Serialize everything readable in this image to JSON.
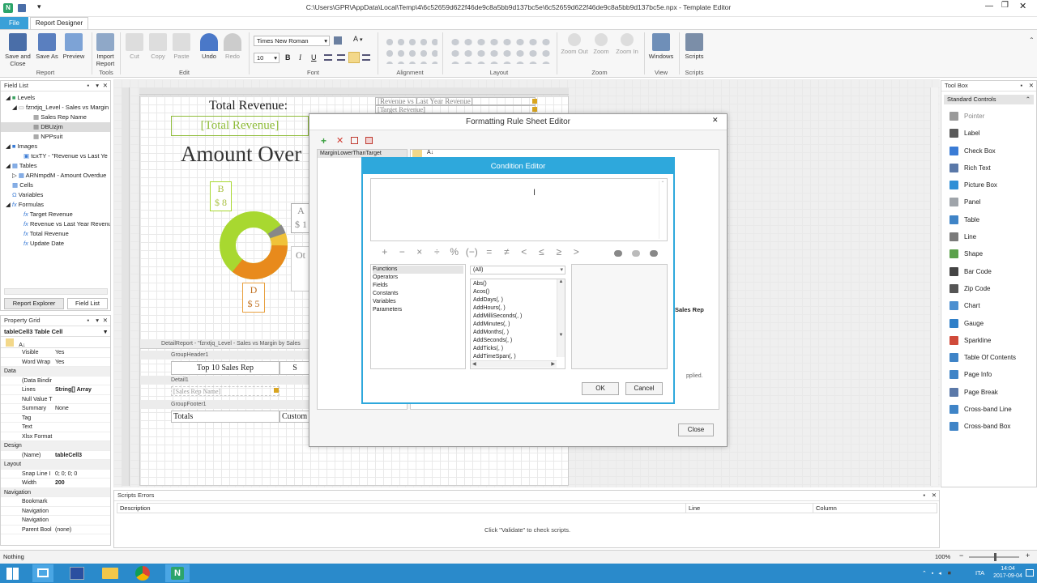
{
  "window": {
    "title": "C:\\Users\\GPR\\AppData\\Local\\Temp\\4\\6c52659d622f46de9c8a5bb9d137bc5e\\6c52659d622f46de9c8a5bb9d137bc5e.npx - Template Editor",
    "tab_file": "File",
    "tab_report_designer": "Report Designer"
  },
  "ribbon": {
    "save_close": "Save and Close",
    "save_as": "Save As",
    "preview": "Preview",
    "import_report": "Import Report",
    "cut": "Cut",
    "copy": "Copy",
    "paste": "Paste",
    "undo": "Undo",
    "redo": "Redo",
    "font_name": "Times New Roman",
    "font_size": "10",
    "zoom_out": "Zoom Out",
    "zoom": "Zoom",
    "zoom_in": "Zoom In",
    "windows": "Windows",
    "scripts": "Scripts",
    "groups": {
      "report": "Report",
      "tools": "Tools",
      "edit": "Edit",
      "font": "Font",
      "alignment": "Alignment",
      "layout": "Layout",
      "zoom": "Zoom",
      "view": "View",
      "scripts": "Scripts"
    }
  },
  "field_list": {
    "title": "Field List",
    "items": [
      "Levels",
      "fzrxtjq_Level - Sales vs Margin",
      "Sales Rep Name",
      "DBUzjm",
      "NPPsuit",
      "Images",
      "tcxTY - \"Revenue vs Last Ye",
      "Tables",
      "ARNmpdM - Amount Overdue",
      "Cells",
      "Variables",
      "Formulas",
      "Target Revenue",
      "Revenue vs Last Year Revenue",
      "Total Revenue",
      "Update Date"
    ],
    "tab_report_explorer": "Report Explorer",
    "tab_field_list": "Field List"
  },
  "property_grid": {
    "title": "Property Grid",
    "selected": "tableCell3   Table Cell",
    "rows": [
      {
        "k": "Visible",
        "v": "Yes"
      },
      {
        "k": "Word Wrap",
        "v": "Yes"
      },
      {
        "k": "Data",
        "v": "",
        "cat": true
      },
      {
        "k": "(Data Bindir",
        "v": ""
      },
      {
        "k": "Lines",
        "v": "String[] Array",
        "bold": true
      },
      {
        "k": "Null Value T",
        "v": ""
      },
      {
        "k": "Summary",
        "v": "None"
      },
      {
        "k": "Tag",
        "v": ""
      },
      {
        "k": "Text",
        "v": ""
      },
      {
        "k": "Xlsx Format",
        "v": ""
      },
      {
        "k": "Design",
        "v": "",
        "cat": true
      },
      {
        "k": "(Name)",
        "v": "tableCell3",
        "bold": true
      },
      {
        "k": "Layout",
        "v": "",
        "cat": true
      },
      {
        "k": "Snap Line I",
        "v": "0; 0; 0; 0"
      },
      {
        "k": "Width",
        "v": "200",
        "bold": true
      },
      {
        "k": "Navigation",
        "v": "",
        "cat": true
      },
      {
        "k": "Bookmark",
        "v": ""
      },
      {
        "k": "Navigation",
        "v": ""
      },
      {
        "k": "Navigation",
        "v": ""
      },
      {
        "k": "Parent Bool",
        "v": "(none)"
      }
    ]
  },
  "report": {
    "total_revenue_label": "Total Revenue:",
    "total_revenue_field": "[Total Revenue]",
    "rev_vs_last": "[Revenue vs Last Year Revenue]",
    "target_revenue": "[Target Revenue]",
    "amount_overdue": "Amount Over",
    "donut_b": "B",
    "donut_b_val": "$ 8",
    "donut_a": "A",
    "donut_a_val": "$ 1",
    "donut_d": "D",
    "donut_d_val": "$ 5",
    "donut_ot": "Ot",
    "detail_report": "DetailReport - \"fzrxtjq_Level - Sales vs Margin by Sales",
    "group_header": "GroupHeader1",
    "top10": "Top 10 Sales Rep",
    "top10_s": "S",
    "detail1": "Detail1",
    "sales_rep_name": "[Sales Rep Name]",
    "group_footer": "GroupFooter1",
    "totals": "Totals",
    "custom": "Custom",
    "sales_rep_right": "Sales Rep",
    "applied": "pplied."
  },
  "formatting_dialog": {
    "title": "Formatting Rule Sheet Editor",
    "rule_item": "MarginLowerThanTarget",
    "close": "Close"
  },
  "condition_editor": {
    "title": "Condition Editor",
    "operators": [
      "+",
      "−",
      "×",
      "÷",
      "%",
      "(−)",
      "=",
      "≠",
      "<",
      "≤",
      "≥",
      ">"
    ],
    "categories": [
      "Functions",
      "Operators",
      "Fields",
      "Constants",
      "Variables",
      "Parameters"
    ],
    "filter": "(All)",
    "functions": [
      "Abs()",
      "Acos()",
      "AddDays(, )",
      "AddHours(, )",
      "AddMilliSeconds(, )",
      "AddMinutes(, )",
      "AddMonths(, )",
      "AddSeconds(, )",
      "AddTicks(, )",
      "AddTimeSpan(, )"
    ],
    "ok": "OK",
    "cancel": "Cancel"
  },
  "toolbox": {
    "title": "Tool Box",
    "section": "Standard Controls",
    "items": [
      {
        "label": "Pointer",
        "color": "#9a9a9a"
      },
      {
        "label": "Label",
        "color": "#5a5a5a"
      },
      {
        "label": "Check Box",
        "color": "#3a7bd5"
      },
      {
        "label": "Rich Text",
        "color": "#5a78a8"
      },
      {
        "label": "Picture Box",
        "color": "#2f8fd6"
      },
      {
        "label": "Panel",
        "color": "#9fa4aa"
      },
      {
        "label": "Table",
        "color": "#3f84c7"
      },
      {
        "label": "Line",
        "color": "#7a7a7a"
      },
      {
        "label": "Shape",
        "color": "#5aa04a"
      },
      {
        "label": "Bar Code",
        "color": "#444444"
      },
      {
        "label": "Zip Code",
        "color": "#555555"
      },
      {
        "label": "Chart",
        "color": "#4b8fd0"
      },
      {
        "label": "Gauge",
        "color": "#2f7fc8"
      },
      {
        "label": "Sparkline",
        "color": "#d04a3a"
      },
      {
        "label": "Table Of Contents",
        "color": "#3f84c7"
      },
      {
        "label": "Page Info",
        "color": "#3f84c7"
      },
      {
        "label": "Page Break",
        "color": "#5a78a8"
      },
      {
        "label": "Cross-band Line",
        "color": "#3f84c7"
      },
      {
        "label": "Cross-band Box",
        "color": "#3f84c7"
      }
    ]
  },
  "scripts_errors": {
    "title": "Scripts Errors",
    "col_description": "Description",
    "col_line": "Line",
    "col_column": "Column",
    "hint": "Click \"Validate\" to check scripts."
  },
  "status": {
    "text": "Nothing",
    "zoom": "100%"
  },
  "taskbar": {
    "lang": "ITA",
    "time": "14:04",
    "date": "2017-09-04"
  },
  "colors": {
    "accent": "#2ea8dc",
    "taskbar": "#2a8acb",
    "report_green": "#8fbc3a"
  }
}
